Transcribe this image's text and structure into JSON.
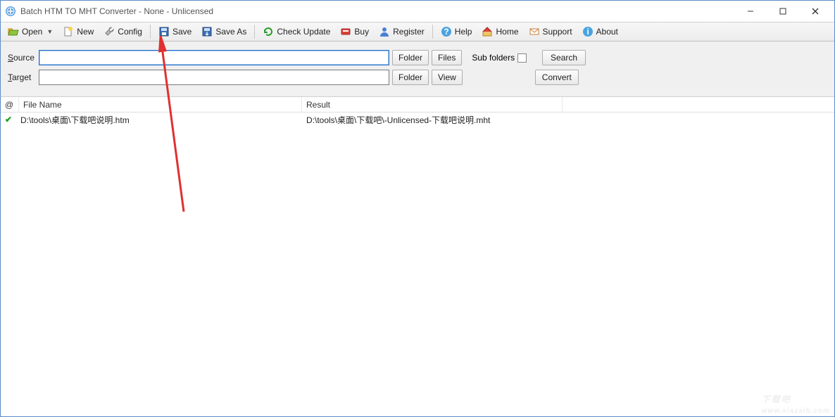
{
  "window": {
    "title": "Batch HTM TO MHT Converter - None - Unlicensed"
  },
  "toolbar": {
    "open": "Open",
    "new": "New",
    "config": "Config",
    "save": "Save",
    "saveas": "Save As",
    "check": "Check Update",
    "buy": "Buy",
    "register": "Register",
    "help": "Help",
    "home": "Home",
    "support": "Support",
    "about": "About"
  },
  "form": {
    "source_label": "Source",
    "source_value": "",
    "target_label": "Target",
    "target_value": "",
    "folder_btn": "Folder",
    "files_btn": "Files",
    "view_btn": "View",
    "subfolders_label": "Sub folders",
    "search_btn": "Search",
    "convert_btn": "Convert"
  },
  "grid": {
    "h_at": "@",
    "h_file": "File Name",
    "h_result": "Result",
    "rows": [
      {
        "file": "D:\\tools\\桌面\\下载吧说明.htm",
        "result": "D:\\tools\\桌面\\下载吧\\-Unlicensed-下载吧说明.mht"
      }
    ]
  },
  "watermark": {
    "big": "下载吧",
    "small": "www.xiazaib.com"
  }
}
